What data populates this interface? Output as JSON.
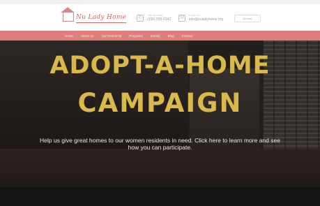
{
  "header": {
    "logo_text": "Nu Lady Home",
    "phone_caption": "Call us today",
    "phone_value": "(330) 555-0142",
    "email_caption": "Email us",
    "email_value": "info@nuladyhome.org",
    "button_label": "Donate"
  },
  "nav": {
    "items": [
      "Home",
      "About Us",
      "Our Residents",
      "Programs",
      "Events",
      "Blog",
      "Contact"
    ]
  },
  "hero": {
    "title_line1": "ADOPT-A-HOME",
    "title_line2": "CAMPAIGN",
    "text_line1": "Help us give great homes to our women residents in need. Click here to learn more and see",
    "text_line2": "how you can participate."
  },
  "colors": {
    "accent": "#e07f7a",
    "title": "#d9b94a",
    "hero_bg": "#2c2724"
  }
}
